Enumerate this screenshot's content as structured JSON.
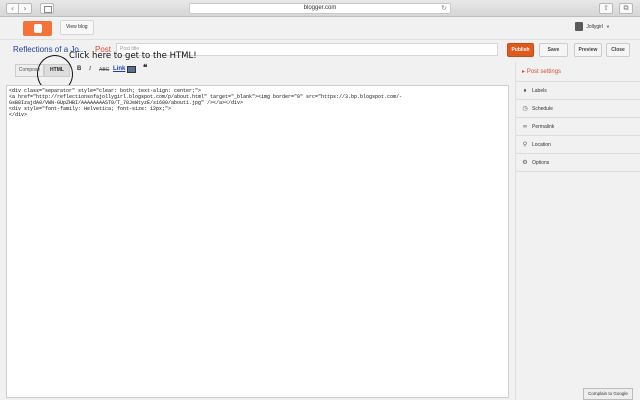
{
  "browser": {
    "url": "blogger.com"
  },
  "header": {
    "view_blog_label": "View blog",
    "user_name": "Jollygirl"
  },
  "post": {
    "blog_name": "Reflections of a Jo...",
    "post_label": "Post",
    "title_placeholder": "Post title"
  },
  "actions": {
    "publish": "Publish",
    "save": "Save",
    "preview": "Preview",
    "close": "Close"
  },
  "toolbar": {
    "compose": "Compose",
    "html": "HTML",
    "bold": "B",
    "italic": "I",
    "strike": "ABC",
    "link": "Link",
    "quote": "❝"
  },
  "annotation": "Click here to get to the HTML!",
  "editor": {
    "content": "<div class=\"separator\" style=\"clear: both; text-align: center;\">\n<a href=\"http://reflectionsofajollygirl.blogspot.com/p/about.html\" target=\"_blank\"><img border=\"0\" src=\"https://3.bp.blogspot.com/-\nGsB8IzajdA0/VWN-GUpZHBI/AAAAAAAAST0/T_78JeWtyzE/s1600/about1.jpg\" /></a></div>\n<div style=\"font-family: Helvetica; font-size: 12px;\">\n</div>"
  },
  "settings": {
    "title": "Post settings",
    "items": [
      {
        "label": "Labels",
        "icon": "tag-icon"
      },
      {
        "label": "Schedule",
        "icon": "clock-icon"
      },
      {
        "label": "Permalink",
        "icon": "link-icon"
      },
      {
        "label": "Location",
        "icon": "pin-icon"
      },
      {
        "label": "Options",
        "icon": "gear-icon"
      }
    ]
  },
  "footer": {
    "complain": "Complain to Google"
  },
  "colors": {
    "accent": "#dd4b39",
    "publish": "#e0591f",
    "blog_name": "#21409a"
  }
}
